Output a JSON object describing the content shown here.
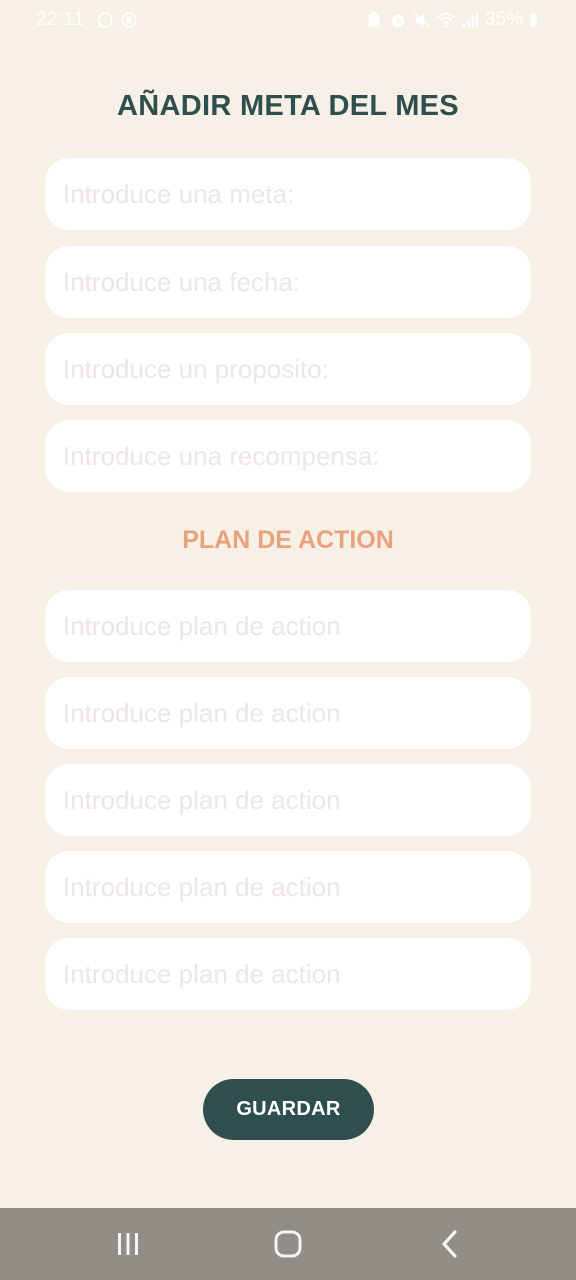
{
  "status_bar": {
    "time": "22:11",
    "battery": "35%",
    "left_icons": [
      "whatsapp-icon",
      "record-icon"
    ],
    "right_icons": [
      "clipboard-icon",
      "alarm-icon",
      "mute-icon",
      "wifi-icon",
      "signal-icon",
      "battery-icon"
    ]
  },
  "title": "AÑADIR META DEL MES",
  "fields": [
    {
      "placeholder": "Introduce una meta:",
      "value": ""
    },
    {
      "placeholder": "Introduce una fecha:",
      "value": ""
    },
    {
      "placeholder": "Introduce un proposito:",
      "value": ""
    },
    {
      "placeholder": "Introduce una recompensa:",
      "value": ""
    }
  ],
  "plan_section": {
    "title": "PLAN DE ACTION",
    "fields": [
      {
        "placeholder": "Introduce plan de action",
        "value": ""
      },
      {
        "placeholder": "Introduce plan de action",
        "value": ""
      },
      {
        "placeholder": "Introduce plan de action",
        "value": ""
      },
      {
        "placeholder": "Introduce plan de action",
        "value": ""
      },
      {
        "placeholder": "Introduce plan de action",
        "value": ""
      }
    ]
  },
  "save_button": {
    "label": "GUARDAR"
  },
  "nav_bar": {
    "icons": [
      "recent-apps-icon",
      "home-icon",
      "back-icon"
    ]
  },
  "colors": {
    "background": "#f7f0e6",
    "primary": "#2f4f4e",
    "accent": "#e9a37c",
    "field_bg": "#ffffff",
    "nav_bg": "#918e88"
  }
}
